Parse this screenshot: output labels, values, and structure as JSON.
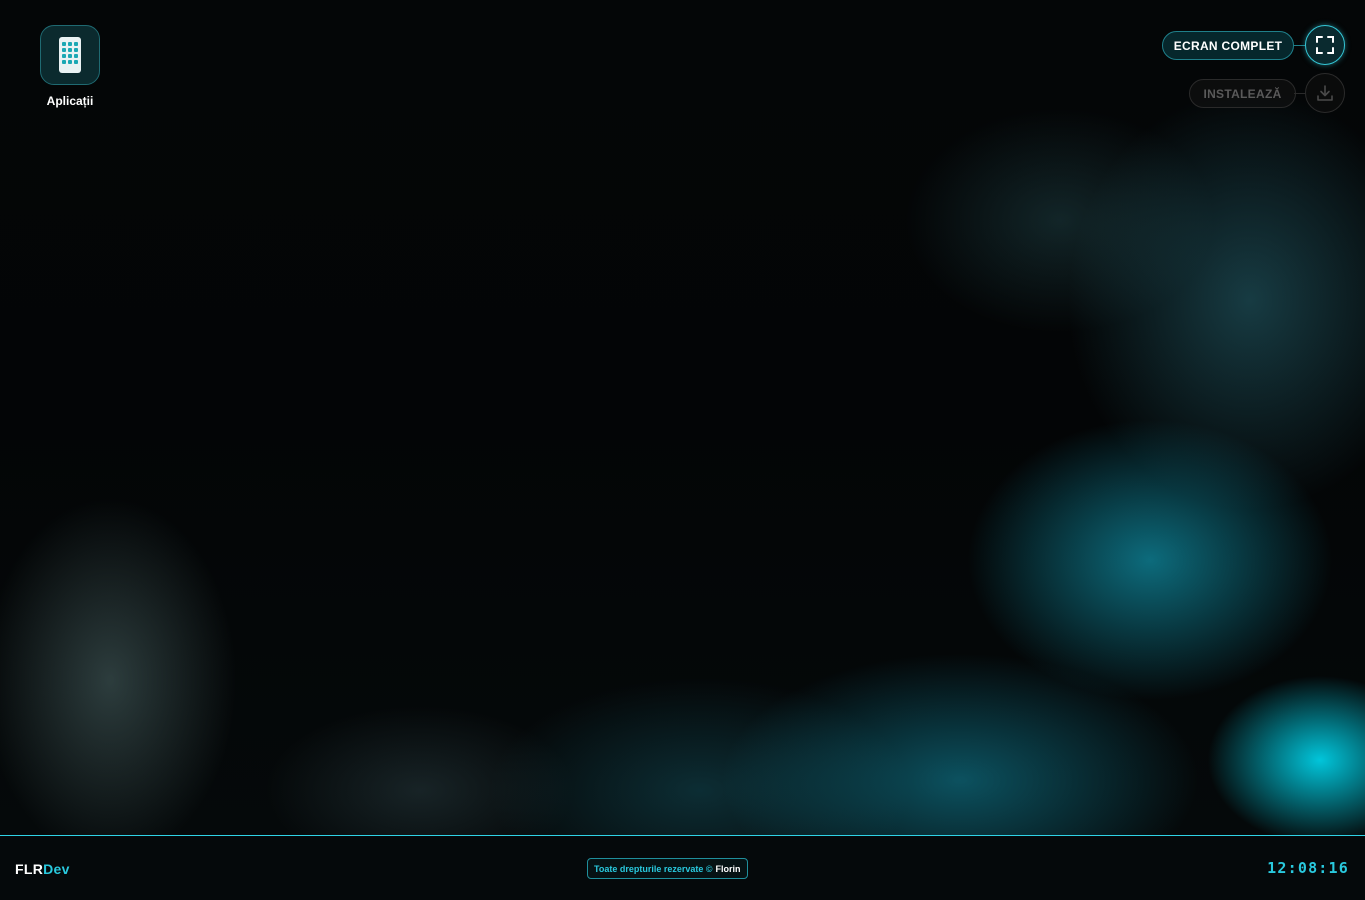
{
  "desktop": {
    "apps_icon": {
      "label": "Aplicații",
      "icon": "apps-phone-icon"
    }
  },
  "top_right": {
    "fullscreen_label": "ECRAN COMPLET",
    "fullscreen_icon": "fullscreen-icon",
    "install_label": "INSTALEAZĂ",
    "install_icon": "download-icon",
    "install_enabled": false
  },
  "taskbar": {
    "brand_part1": "FLR",
    "brand_part2": "Dev",
    "copyright_text": "Toate drepturile rezervate ©",
    "copyright_name": "Florin",
    "clock": "12:08:16"
  },
  "colors": {
    "accent": "#29c9de",
    "background": "#030506",
    "taskbar": "#05090b"
  }
}
